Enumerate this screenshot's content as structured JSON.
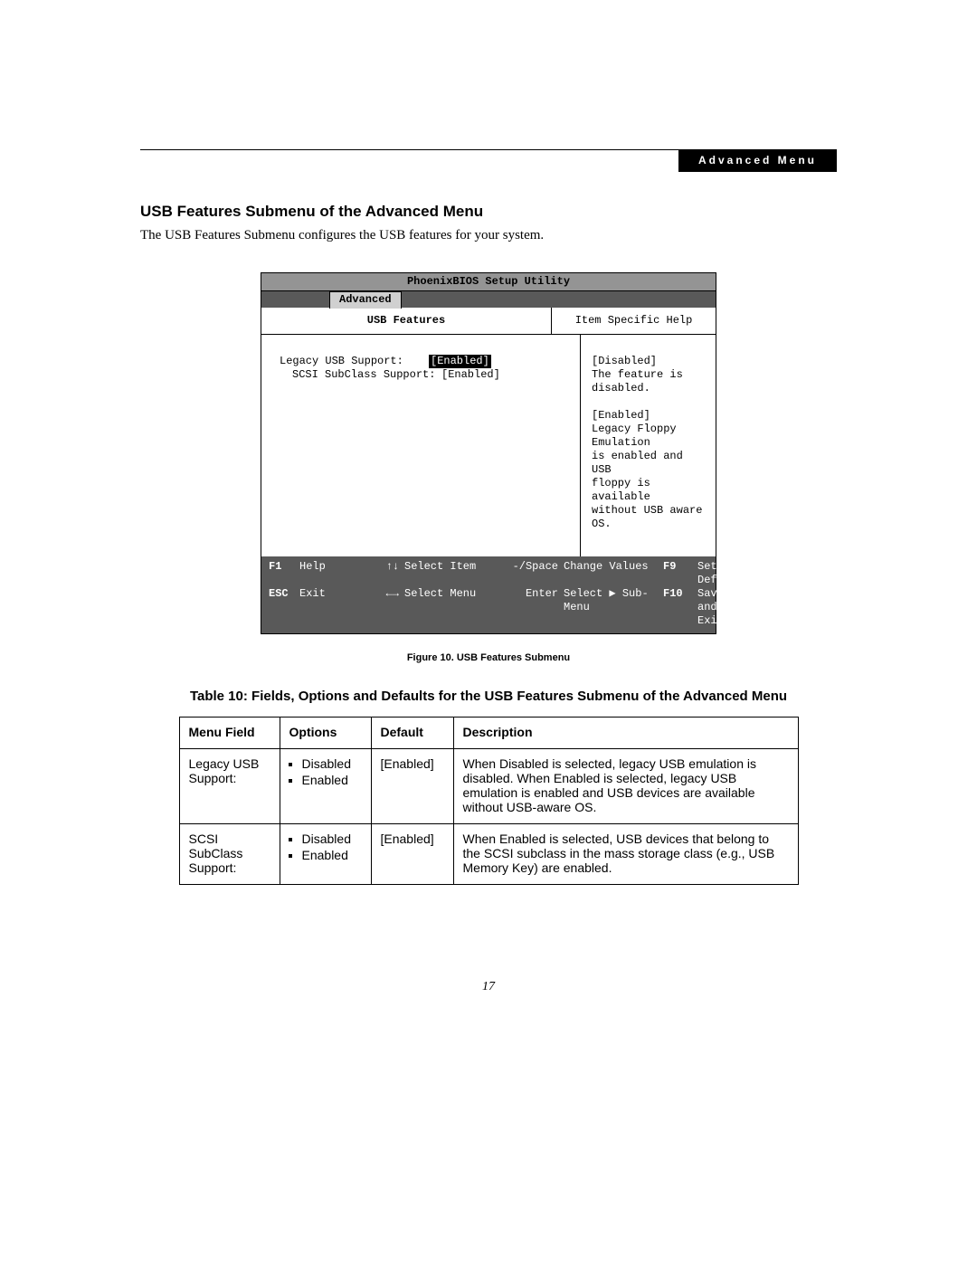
{
  "header": {
    "breadcrumb": "Advanced Menu"
  },
  "page": {
    "section_title": "USB Features Submenu of the Advanced Menu",
    "intro": "The USB Features Submenu configures the USB features for your system.",
    "figure_caption": "Figure 10.   USB Features Submenu",
    "table_caption": "Table 10: Fields, Options and Defaults for the USB Features Submenu of the Advanced Menu",
    "page_number": "17"
  },
  "bios": {
    "title": "PhoenixBIOS Setup Utility",
    "active_tab": "Advanced",
    "left_header": "USB Features",
    "right_header": "Item Specific Help",
    "settings": [
      {
        "label": "Legacy USB Support:",
        "value": "[Enabled]",
        "selected": true
      },
      {
        "label": "SCSI SubClass Support:",
        "value": "[Enabled]",
        "selected": false
      }
    ],
    "help": {
      "disabled_label": "[Disabled]",
      "disabled_desc": "The feature is disabled.",
      "enabled_label": "[Enabled]",
      "enabled_desc1": "Legacy Floppy Emulation",
      "enabled_desc2": "is enabled and USB",
      "enabled_desc3": "floppy is available",
      "enabled_desc4": "without USB aware OS."
    },
    "footer": {
      "r1": {
        "k1": "F1",
        "a1": "Help",
        "s1": "↑↓",
        "d1": "Select Item",
        "s2": "-/Space",
        "d2": "Change Values",
        "k2": "F9",
        "a2": "Setup Defaults"
      },
      "r2": {
        "k1": "ESC",
        "a1": "Exit",
        "s1": "←→",
        "d1": "Select Menu",
        "s2": "Enter",
        "d2": "Select ▶ Sub-Menu",
        "k2": "F10",
        "a2": "Save and Exit"
      }
    }
  },
  "table": {
    "headers": [
      "Menu Field",
      "Options",
      "Default",
      "Description"
    ],
    "rows": [
      {
        "menu_field": "Legacy USB Support:",
        "options": [
          "Disabled",
          "Enabled"
        ],
        "default": "[Enabled]",
        "description": "When Disabled is selected, legacy USB emulation is disabled. When Enabled is selected, legacy USB emulation is enabled and USB devices are available without USB-aware OS."
      },
      {
        "menu_field": "SCSI SubClass Support:",
        "options": [
          "Disabled",
          "Enabled"
        ],
        "default": "[Enabled]",
        "description": "When Enabled is selected, USB devices that belong to the SCSI subclass in the mass storage class (e.g., USB Memory Key) are enabled."
      }
    ]
  }
}
